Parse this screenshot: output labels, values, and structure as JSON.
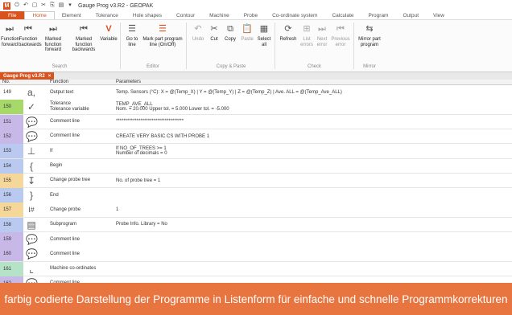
{
  "window": {
    "title": "Gauge Prog v3.R2 - GEOPAK",
    "logo_letter": "M"
  },
  "menu": [
    "File",
    "Home",
    "Element",
    "Tolerance",
    "Hole shapes",
    "Contour",
    "Machine",
    "Probe",
    "Co-ordinate system",
    "Calculate",
    "Program",
    "Output",
    "View"
  ],
  "ribbon": {
    "buttons": [
      {
        "label1": "Function",
        "label2": "forward",
        "icon": "step-forward-icon"
      },
      {
        "label1": "Function",
        "label2": "backwards",
        "icon": "step-back-icon"
      },
      {
        "label1": "Marked function",
        "label2": "forward",
        "icon": "marked-forward-icon"
      },
      {
        "label1": "Marked function",
        "label2": "backwards",
        "icon": "marked-back-icon"
      },
      {
        "label1": "Variable",
        "label2": "",
        "icon": "variable-icon"
      },
      {
        "label1": "Go to",
        "label2": "line",
        "icon": "goto-line-icon"
      },
      {
        "label1": "Mark part program",
        "label2": "line (On/Off)",
        "icon": "mark-line-icon"
      },
      {
        "label1": "Undo",
        "label2": "",
        "icon": "undo-icon"
      },
      {
        "label1": "Cut",
        "label2": "",
        "icon": "cut-icon"
      },
      {
        "label1": "Copy",
        "label2": "",
        "icon": "copy-icon"
      },
      {
        "label1": "Paste",
        "label2": "",
        "icon": "paste-icon"
      },
      {
        "label1": "Select",
        "label2": "all",
        "icon": "select-all-icon"
      },
      {
        "label1": "Refresh",
        "label2": "",
        "icon": "refresh-icon"
      },
      {
        "label1": "List",
        "label2": "errors",
        "icon": "list-errors-icon"
      },
      {
        "label1": "Next",
        "label2": "error",
        "icon": "next-error-icon"
      },
      {
        "label1": "Previous",
        "label2": "error",
        "icon": "previous-error-icon"
      },
      {
        "label1": "Mirror part",
        "label2": "program",
        "icon": "mirror-icon"
      }
    ],
    "groups": [
      "Search",
      "Editor",
      "Copy & Paste",
      "Check",
      "Mirror"
    ]
  },
  "doc_tab": {
    "label": "Gauge Prog v3.R2",
    "close": "×"
  },
  "table": {
    "headers": [
      "No.",
      "Function",
      "Parameters"
    ],
    "rows": [
      {
        "no": "149",
        "function": "Output text",
        "params": [
          "Temp. Sensors (°C): X = @(Temp_X) | Y = @(Temp_Y) | Z = @(Temp_Z) | Ave. ALL = @(Temp_Ave_ALL)"
        ],
        "color": "#ffffff",
        "icon": "text-a-icon"
      },
      {
        "no": "150",
        "function": "Tolerance\nTolerance variable",
        "params": [
          "TEMP_AVE_ALL",
          "Nom. = 20.000  Upper tol. = 5.000  Lower tol. = -5.000"
        ],
        "color": "#a6d96a",
        "icon": "tolerance-icon"
      },
      {
        "no": "151",
        "function": "Comment line",
        "params": [
          "************************************"
        ],
        "color": "#c8b8e8",
        "icon": "comment-icon"
      },
      {
        "no": "152",
        "function": "Comment line",
        "params": [
          "CREATE VERY BASIC CS WITH PROBE 1"
        ],
        "color": "#c8b8e8",
        "icon": "comment-icon"
      },
      {
        "no": "153",
        "function": "If",
        "params": [
          "If NO_OF_TREES >= 1",
          "Number of decimals = 0"
        ],
        "color": "#b9c9f0",
        "icon": "if-branch-icon"
      },
      {
        "no": "154",
        "function": "Begin",
        "params": [
          ""
        ],
        "color": "#b9c9f0",
        "icon": "begin-brace-icon"
      },
      {
        "no": "155",
        "function": "Change probe tree",
        "params": [
          "No. of probe tree = 1"
        ],
        "color": "#f6d79a",
        "icon": "probe-tree-icon"
      },
      {
        "no": "156",
        "function": "End",
        "params": [
          ""
        ],
        "color": "#b9c9f0",
        "icon": "end-brace-icon"
      },
      {
        "no": "157",
        "function": "Change probe",
        "params": [
          "1"
        ],
        "color": "#f6d79a",
        "icon": "probe-icon"
      },
      {
        "no": "158",
        "function": "Subprogram",
        "params": [
          "Probe Info. Library = No"
        ],
        "color": "#b9c9f0",
        "icon": "subprogram-icon"
      },
      {
        "no": "159",
        "function": "Comment line",
        "params": [
          ""
        ],
        "color": "#c8b8e8",
        "icon": "comment-icon"
      },
      {
        "no": "160",
        "function": "Comment line",
        "params": [
          ""
        ],
        "color": "#c8b8e8",
        "icon": "comment-icon"
      },
      {
        "no": "161",
        "function": "Machine co-ordinates",
        "params": [
          ""
        ],
        "color": "#b6e3c8",
        "icon": "machine-coords-icon"
      },
      {
        "no": "162",
        "function": "Comment line",
        "params": [
          ""
        ],
        "color": "#c8b8e8",
        "icon": "comment-icon"
      }
    ]
  },
  "caption": "farbig codierte Darstellung der Programme in Listenform für einfache und schnelle Programmkorrekturen",
  "colors": {
    "accent": "#d9531e",
    "caption_bg": "#e8743f"
  }
}
